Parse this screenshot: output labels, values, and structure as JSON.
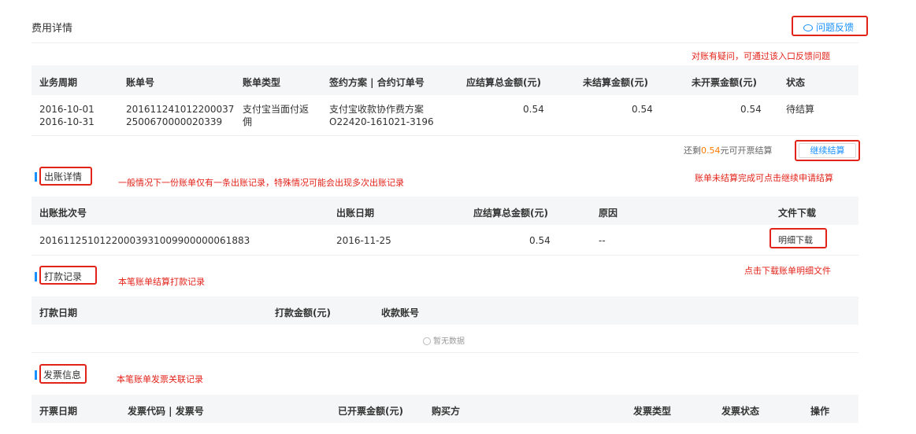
{
  "page_title": "费用详情",
  "feedback_button": "问题反馈",
  "annotations": {
    "feedback": "对账有疑问，可通过该入口反馈问题",
    "continue": "账单未结算完成可点击继续申请结算",
    "billing": "一般情况下一份账单仅有一条出账记录，特殊情况可能会出现多次出账记录",
    "download": "点击下载账单明细文件",
    "payment": "本笔账单结算打款记录",
    "invoice": "本笔账单发票关联记录"
  },
  "bill_table": {
    "headers": [
      "业务周期",
      "账单号",
      "账单类型",
      "签约方案 | 合约订单号",
      "应结算总金额(元)",
      "未结算金额(元)",
      "未开票金额(元)",
      "状态"
    ],
    "row": {
      "period_start": "2016-10-01",
      "period_end": "2016-10-31",
      "bill_no_1": "201611241012200037",
      "bill_no_2": "2500670000020339",
      "bill_type_1": "支付宝当面付返",
      "bill_type_2": "佣",
      "plan_1": "支付宝收款协作费方案",
      "plan_2": "O22420-161021-3196",
      "total": "0.54",
      "unsettled": "0.54",
      "uninvoiced": "0.54",
      "status": "待结算"
    }
  },
  "remaining": {
    "prefix": "还剩",
    "amount": "0.54",
    "suffix": "元可开票结算"
  },
  "continue_button": "继续结算",
  "billing_section": {
    "title": "出账详情",
    "headers": [
      "出账批次号",
      "出账日期",
      "应结算总金额(元)",
      "原因",
      "文件下载"
    ],
    "row": {
      "batch_no": "20161125101220003931009900000061883",
      "date": "2016-11-25",
      "total": "0.54",
      "reason": "--",
      "download": "明细下载"
    }
  },
  "payment_section": {
    "title": "打款记录",
    "headers": [
      "打款日期",
      "打款金额(元)",
      "收款账号"
    ],
    "empty": "暂无数据"
  },
  "invoice_section": {
    "title": "发票信息",
    "headers": [
      "开票日期",
      "发票代码 | 发票号",
      "已开票金额(元)",
      "购买方",
      "发票类型",
      "发票状态",
      "操作"
    ]
  },
  "colors": {
    "annotation_red": "#e2231a",
    "link_blue": "#1890ff",
    "amount_orange": "#ff7a00",
    "header_bg": "#f5f6f7"
  }
}
